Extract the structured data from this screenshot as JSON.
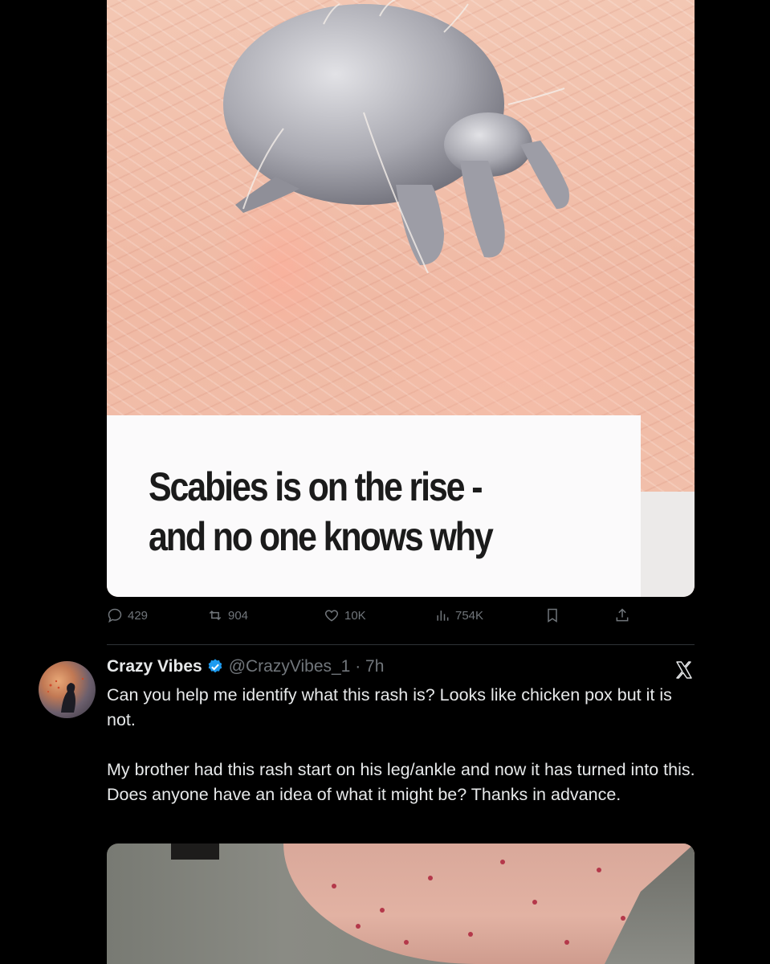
{
  "article": {
    "headline_line1": "Scabies is on the rise -",
    "headline_line2": "and no one knows why"
  },
  "actions": {
    "replies": "429",
    "reposts": "904",
    "likes": "10K",
    "views": "754K"
  },
  "tweet": {
    "name": "Crazy Vibes",
    "handle_time": "@CrazyVibes_1 · 7h",
    "text": "Can you help me identify what this rash is? Looks like chicken pox but it is not.\n\nMy brother had this rash start on his leg/ankle and now it has turned into this. Does anyone have an idea of what it might be? Thanks in advance."
  },
  "colors": {
    "background": "#000000",
    "text": "#e7e9ea",
    "muted": "#71767b",
    "verified": "#1d9bf0"
  },
  "icons": [
    "reply-icon",
    "repost-icon",
    "like-icon",
    "views-icon",
    "bookmark-icon",
    "share-icon",
    "verified-icon",
    "x-logo-icon"
  ]
}
